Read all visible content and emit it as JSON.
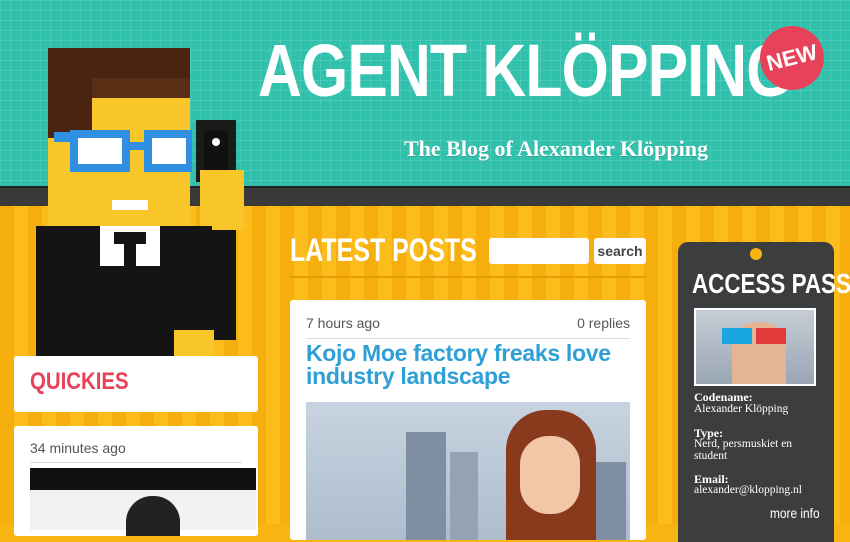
{
  "header": {
    "title": "AGENT KLÖPPING",
    "subtitle": "The Blog of Alexander Klöpping",
    "badge": "NEW",
    "colors": {
      "teal": "#2fc1ac",
      "badge": "#e8425a"
    }
  },
  "sidebar": {
    "quickies_label": "QUICKIES",
    "quick_post": {
      "time": "34 minutes ago"
    }
  },
  "main": {
    "heading": "LATEST POSTS",
    "search": {
      "placeholder": "",
      "button_label": "search"
    },
    "post": {
      "time": "7 hours ago",
      "replies": "0 replies",
      "title": "Kojo Moe factory freaks love industry landscape"
    }
  },
  "access_pass": {
    "title": "ACCESS PASS",
    "codename_label": "Codename:",
    "codename": "Alexander Klöpping",
    "type_label": "Type:",
    "type": "Nerd, persmuskiet en student",
    "email_label": "Email:",
    "email": "alexander@klopping.nl",
    "more_info": "more info"
  },
  "colors": {
    "body": "#f8b410",
    "link_blue": "#2f9fd8",
    "pass_bg": "#3b3d3f"
  }
}
